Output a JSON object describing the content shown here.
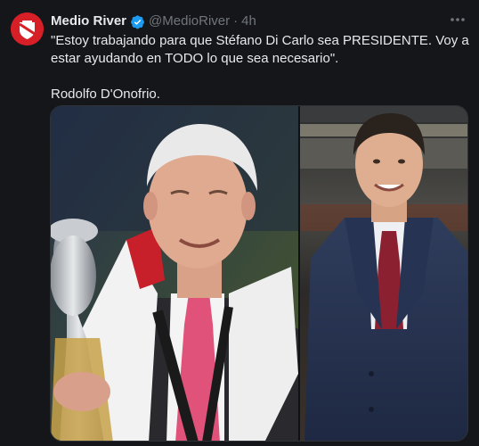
{
  "tweet": {
    "author_name": "Medio River",
    "handle": "@MedioRiver",
    "separator": "·",
    "time": "4h",
    "quote_line": "\"Estoy trabajando para que Stéfano Di Carlo sea PRESIDENTE. Voy a estar ayudando en TODO lo que sea necesario\".",
    "signature": "Rodolfo D'Onofrio.",
    "verified": true,
    "media": {
      "left_photo_alt": "Older man with white hair holding a silver trophy, wearing a red and white scarf and pink tie",
      "right_photo_alt": "Younger man in a dark blue coat and red tie smiling"
    },
    "icons": {
      "avatar": "club-crest-icon",
      "verified": "verified-badge-icon",
      "more": "more-options-icon"
    }
  },
  "colors": {
    "background": "#14161a",
    "text": "#e7e9ea",
    "muted": "#71767b",
    "verified": "#1d9bf0",
    "avatar_red": "#d61f26"
  }
}
